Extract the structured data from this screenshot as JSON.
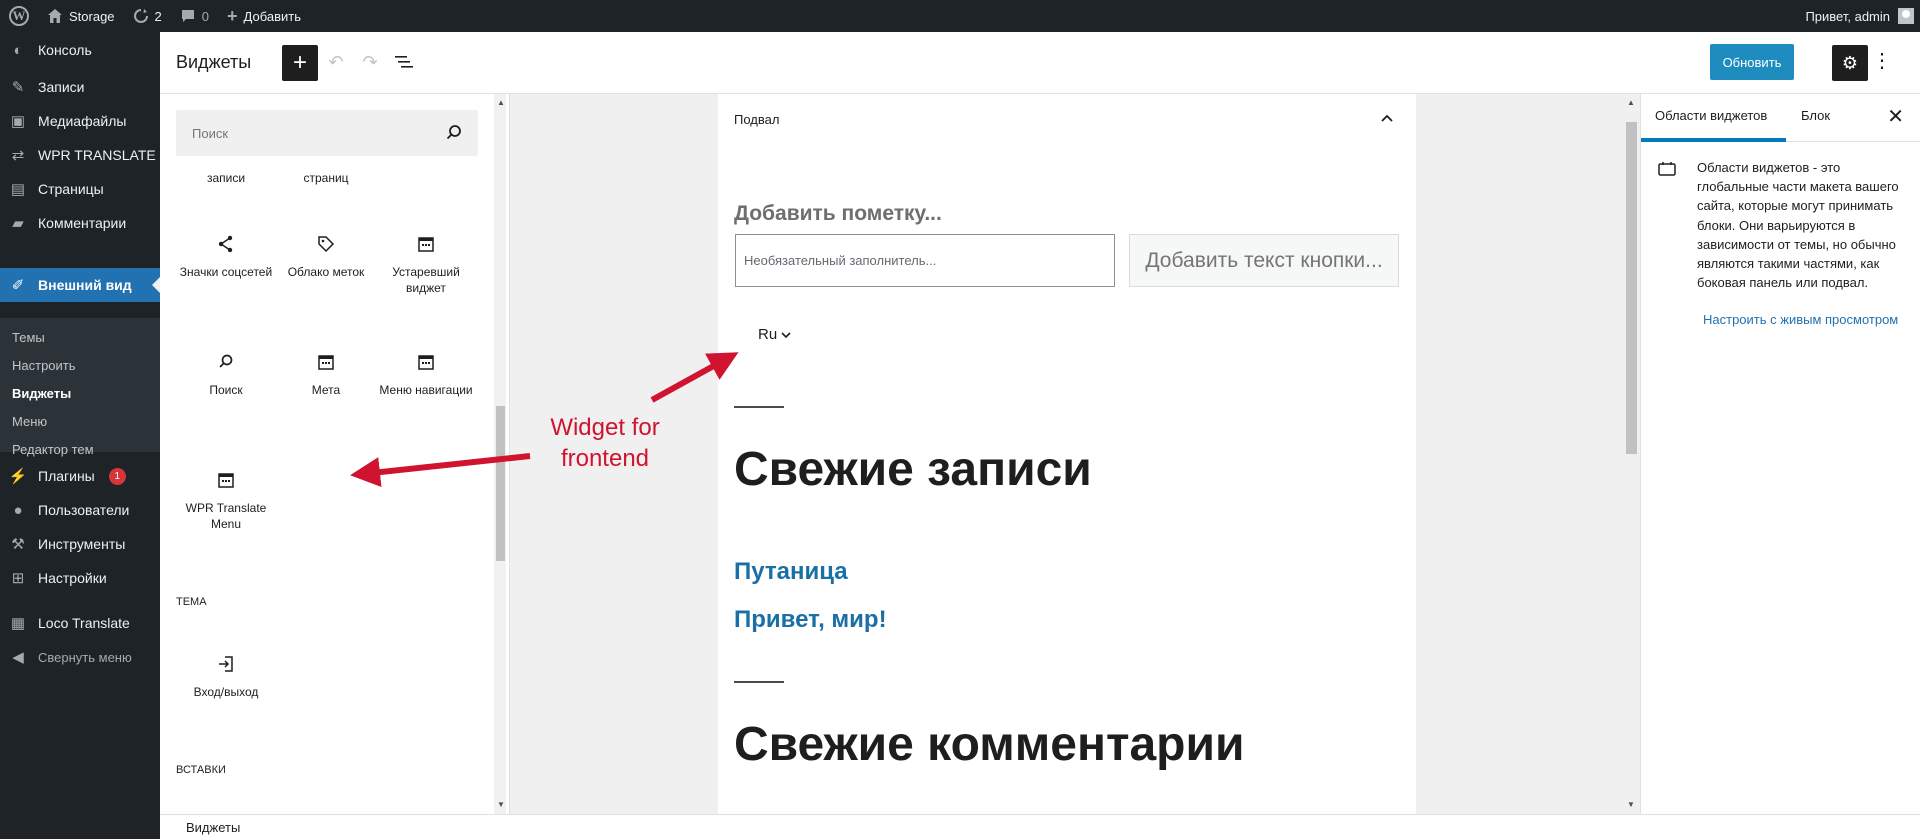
{
  "admin_bar": {
    "site_name": "Storage",
    "updates_count": "2",
    "comments_count": "0",
    "add_new": "Добавить",
    "greeting": "Привет, admin"
  },
  "admin_menu": {
    "items": [
      {
        "label": "Консоль",
        "icon": "dashboard-icon"
      },
      {
        "label": "Записи",
        "icon": "pin-icon"
      },
      {
        "label": "Медиафайлы",
        "icon": "media-icon"
      },
      {
        "label": "WPR TRANSLATE",
        "icon": "translate-icon"
      },
      {
        "label": "Страницы",
        "icon": "pages-icon"
      },
      {
        "label": "Комментарии",
        "icon": "comments-icon"
      },
      {
        "label": "Внешний вид",
        "icon": "brush-icon"
      },
      {
        "label": "Плагины",
        "icon": "plugin-icon",
        "badge": "1"
      },
      {
        "label": "Пользователи",
        "icon": "users-icon"
      },
      {
        "label": "Инструменты",
        "icon": "tools-icon"
      },
      {
        "label": "Настройки",
        "icon": "settings-icon"
      },
      {
        "label": "Loco Translate",
        "icon": "loco-icon"
      }
    ],
    "submenu": [
      "Темы",
      "Настроить",
      "Виджеты",
      "Меню",
      "Редактор тем"
    ],
    "collapse_label": "Свернуть меню"
  },
  "header": {
    "title": "Виджеты",
    "update_button": "Обновить"
  },
  "inserter": {
    "search_placeholder": "Поиск",
    "partial_row": [
      "записи",
      "страниц"
    ],
    "blocks": [
      {
        "label": "Значки соцсетей",
        "icon": "share-icon"
      },
      {
        "label": "Облако меток",
        "icon": "tag-icon"
      },
      {
        "label": "Устаревший виджет",
        "icon": "calendar-icon"
      },
      {
        "label": "Поиск",
        "icon": "search-icon"
      },
      {
        "label": "Мета",
        "icon": "calendar-icon"
      },
      {
        "label": "Меню навигации",
        "icon": "calendar-icon"
      },
      {
        "label": "WPR Translate Menu",
        "icon": "calendar-icon"
      }
    ],
    "section_theme": "ТЕМА",
    "theme_blocks": [
      {
        "label": "Вход/выход",
        "icon": "login-icon"
      }
    ],
    "section_embeds": "ВСТАВКИ"
  },
  "widget_area": {
    "title": "Подвал",
    "note_placeholder": "Добавить пометку...",
    "input_placeholder": "Необязательный заполнитель...",
    "button_placeholder": "Добавить текст кнопки...",
    "lang_selector": "Ru",
    "heading_posts": "Свежие записи",
    "posts": [
      "Путаница",
      "Привет, мир!"
    ],
    "heading_comments": "Свежие комментарии"
  },
  "annotation": {
    "text_line1": "Widget for",
    "text_line2": "frontend",
    "color": "#d0142f"
  },
  "sidebar": {
    "tab_areas": "Области виджетов",
    "tab_block": "Блок",
    "description": "Области виджетов - это глобальные части макета вашего сайта, которые могут принимать блоки. Они варьируются в зависимости от темы, но обычно являются такими частями, как боковая панель или подвал.",
    "live_preview_link": "Настроить с живым просмотром"
  },
  "footer": {
    "breadcrumb": "Виджеты"
  },
  "colors": {
    "admin_dark": "#1d2327",
    "accent": "#2271b1",
    "update_button": "#1e8cbe",
    "link": "#1a6fa7"
  }
}
